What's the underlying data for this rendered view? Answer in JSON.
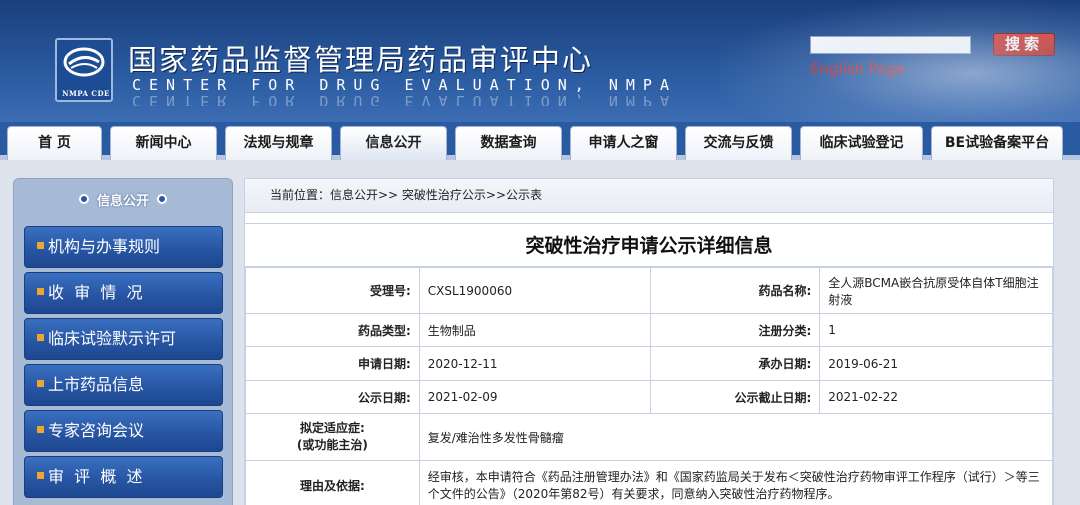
{
  "header": {
    "logo_caption": "NMPA CDE",
    "title_cn": "国家药品监督管理局药品审评中心",
    "title_en": "CENTER FOR DRUG EVALUATION, NMPA",
    "search_placeholder": "",
    "search_button": "搜索",
    "english_link": "English Page"
  },
  "nav": {
    "tabs": [
      {
        "label": "首 页"
      },
      {
        "label": "新闻中心"
      },
      {
        "label": "法规与规章"
      },
      {
        "label": "信息公开"
      },
      {
        "label": "数据查询"
      },
      {
        "label": "申请人之窗"
      },
      {
        "label": "交流与反馈"
      },
      {
        "label": "临床试验登记"
      },
      {
        "label": "BE试验备案平台"
      }
    ],
    "active_index": 3
  },
  "sidebar": {
    "title": "信息公开",
    "items": [
      {
        "label": "机构与办事规则"
      },
      {
        "label": "收  审  情  况"
      },
      {
        "label": "临床试验默示许可"
      },
      {
        "label": "上市药品信息"
      },
      {
        "label": "专家咨询会议"
      },
      {
        "label": "审  评  概  述"
      }
    ]
  },
  "breadcrumb": "当前位置：信息公开>> 突破性治疗公示>>公示表",
  "detail": {
    "title": "突破性治疗申请公示详细信息",
    "rows": [
      {
        "l1": "受理号:",
        "v1": "CXSL1900060",
        "l2": "药品名称:",
        "v2": "全人源BCMA嵌合抗原受体自体T细胞注射液"
      },
      {
        "l1": "药品类型:",
        "v1": "生物制品",
        "l2": "注册分类:",
        "v2": "1"
      },
      {
        "l1": "申请日期:",
        "v1": "2020-12-11",
        "l2": "承办日期:",
        "v2": "2019-06-21"
      },
      {
        "l1": "公示日期:",
        "v1": "2021-02-09",
        "l2": "公示截止日期:",
        "v2": "2021-02-22"
      }
    ],
    "indication_label_1": "拟定适应症:",
    "indication_label_2": "(或功能主治)",
    "indication_value": "复发/难治性多发性骨髓瘤",
    "reason_label": "理由及依据:",
    "reason_value": "经审核，本申请符合《药品注册管理办法》和《国家药监局关于发布＜突破性治疗药物审评工作程序（试行）＞等三个文件的公告》（2020年第82号）有关要求，同意纳入突破性治疗药物程序。"
  }
}
